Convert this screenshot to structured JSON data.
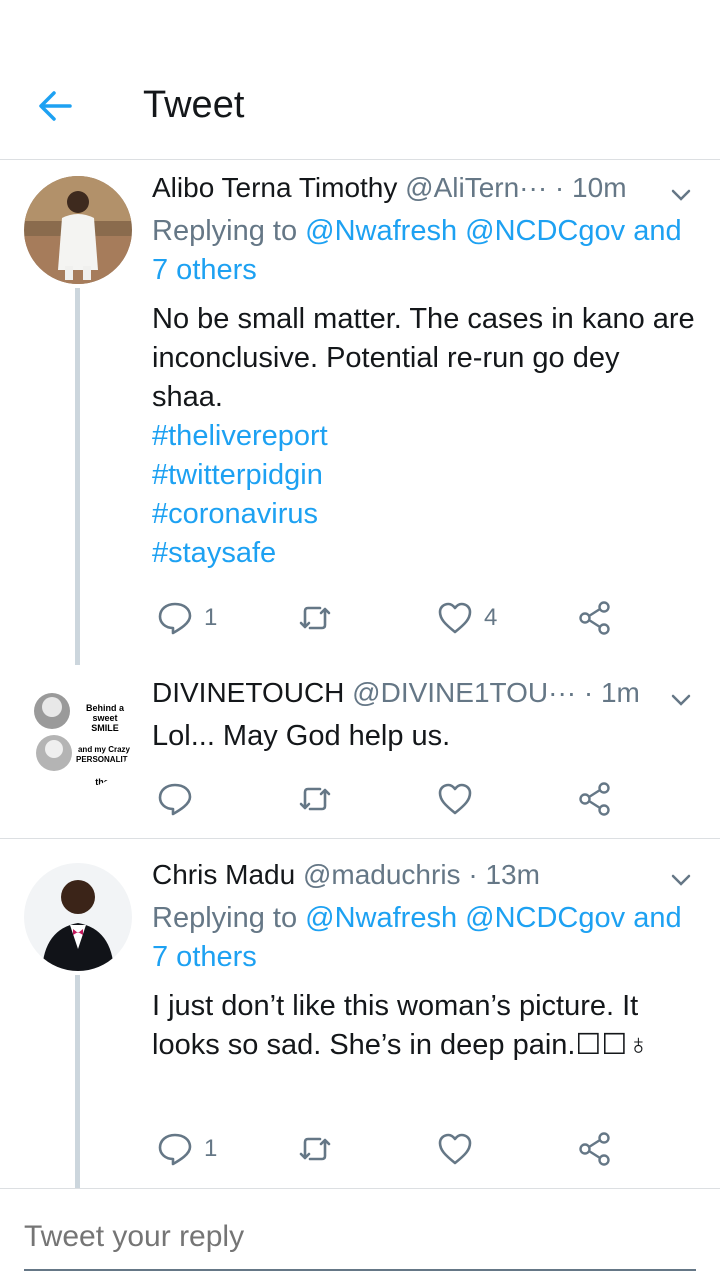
{
  "header": {
    "title": "Tweet",
    "back_icon": "arrow-left-icon"
  },
  "colors": {
    "accent": "#1da1f2",
    "secondary_text": "#657786",
    "primary_text": "#14171a",
    "divider": "#dcdfe2"
  },
  "tweets": [
    {
      "name": "Alibo Terna Timothy",
      "handle": "@AliTern···",
      "sep": " · ",
      "time": "10m",
      "replying_prefix": "Replying to ",
      "mention1": "@Nwafresh",
      "mention2": "@NCDCgov",
      "and_others": "and 7 others",
      "text": "No be small matter. The cases in kano are inconclusive. Potential re-run go dey shaa.",
      "hashtags": [
        "#thelivereport",
        "#twitterpidgin",
        "#coronavirus",
        "#staysafe"
      ],
      "reply_count": "1",
      "retweet_count": "",
      "like_count": "4"
    },
    {
      "name": "DIVINETOUCH",
      "handle": "@DIVINE1TOU···",
      "sep": " · ",
      "time": "1m",
      "text": "Lol... May God help us.",
      "avatar_text1": "Behind a sweet SMILE",
      "avatar_text2": "and my Crazy PERSONALITY",
      "avatar_text3": "the",
      "reply_count": "",
      "retweet_count": "",
      "like_count": ""
    },
    {
      "name": "Chris Madu",
      "handle": "@maduchris",
      "sep": " · ",
      "time": "13m",
      "replying_prefix": "Replying to ",
      "mention1": "@Nwafresh",
      "mention2": "@NCDCgov",
      "and_others": "and 7 others",
      "text": "I just don’t like this woman’s picture. It looks so sad. She’s in deep pain.☐☐♁",
      "reply_count": "1",
      "retweet_count": "",
      "like_count": ""
    }
  ],
  "reply_bar": {
    "placeholder": "Tweet your reply"
  }
}
